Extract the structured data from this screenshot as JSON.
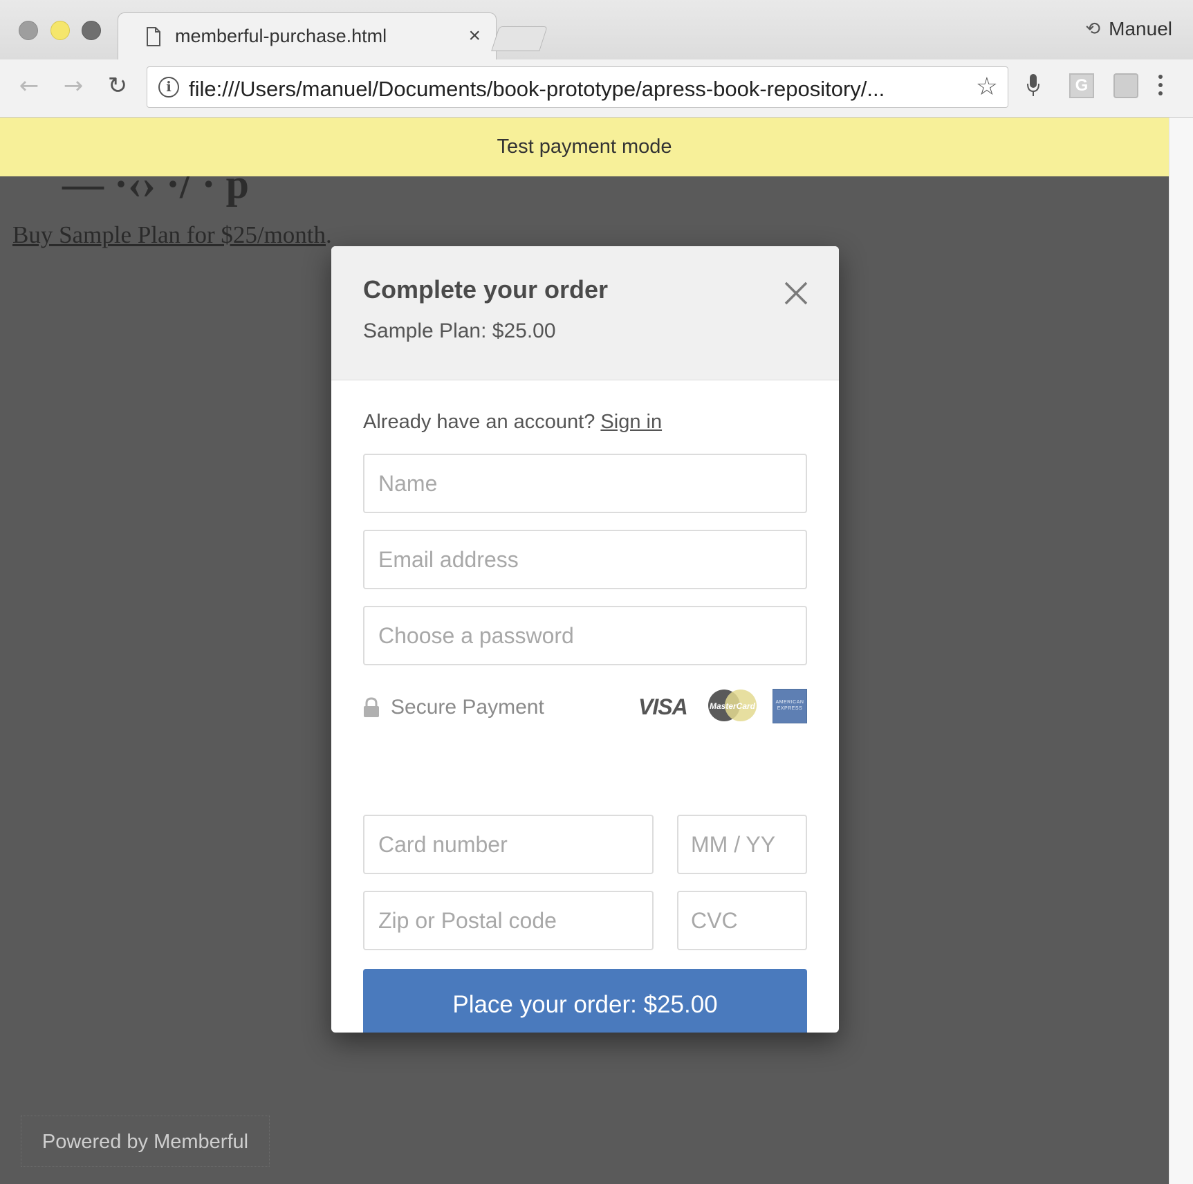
{
  "browser": {
    "tab_title": "memberful-purchase.html",
    "tab_close": "×",
    "profile_name": "Manuel",
    "url": "file:///Users/manuel/Documents/book-prototype/apress-book-repository/...",
    "info_glyph": "i",
    "ext_g_label": "G"
  },
  "page": {
    "banner": "Test payment mode",
    "buy_link": "Buy Sample Plan for $25/month",
    "buy_link_suffix": ".",
    "powered_by": "Powered by Memberful"
  },
  "modal": {
    "title": "Complete your order",
    "subtitle": "Sample Plan: $25.00",
    "account_prompt": "Already have an account? ",
    "sign_in": "Sign in",
    "fields": {
      "name_placeholder": "Name",
      "email_placeholder": "Email address",
      "password_placeholder": "Choose a password",
      "card_placeholder": "Card number",
      "expiry_placeholder": "MM / YY",
      "zip_placeholder": "Zip or Postal code",
      "cvc_placeholder": "CVC"
    },
    "secure_label": "Secure Payment",
    "cards": {
      "visa": "VISA",
      "mastercard": "MasterCard",
      "amex": "AMERICAN EXPRESS"
    },
    "submit_label": "Place your order: $25.00"
  },
  "colors": {
    "banner_bg": "#f7f099",
    "overlay": "#5a5a5a",
    "button": "#4a7abd"
  }
}
